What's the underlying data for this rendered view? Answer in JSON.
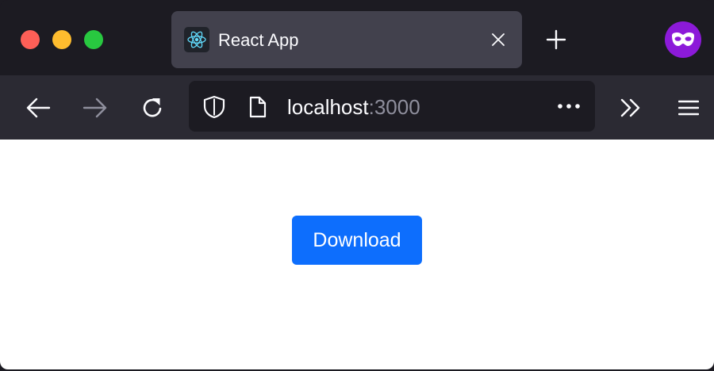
{
  "window": {
    "traffic_lights": [
      "close",
      "minimize",
      "maximize"
    ],
    "colors": {
      "close": "#fe5f57",
      "minimize": "#febc2e",
      "maximize": "#28c840"
    }
  },
  "tab": {
    "title": "React App",
    "favicon": "react-logo-icon",
    "close_icon": "close-icon"
  },
  "tabbar": {
    "new_tab_icon": "plus-icon",
    "private_icon": "private-browsing-mask-icon",
    "private_color": "#8c1ad9"
  },
  "toolbar": {
    "back_icon": "arrow-left-icon",
    "forward_icon": "arrow-right-icon",
    "reload_icon": "reload-icon",
    "overflow_icon": "chevrons-right-icon",
    "menu_icon": "hamburger-menu-icon"
  },
  "urlbar": {
    "host": "localhost",
    "port": ":3000",
    "shield_icon": "shield-icon",
    "page_icon": "page-icon",
    "actions_icon": "more-horizontal-icon"
  },
  "content": {
    "download_label": "Download",
    "button_color": "#0d6efd"
  }
}
